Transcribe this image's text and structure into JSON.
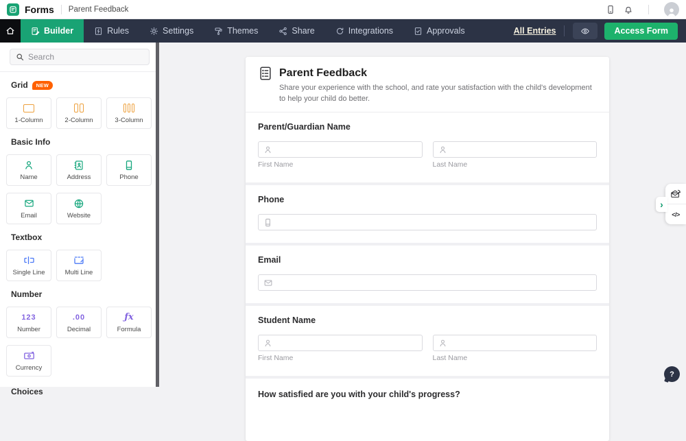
{
  "topbar": {
    "brand": "Forms",
    "form_name": "Parent Feedback"
  },
  "nav": {
    "tabs": [
      {
        "label": "Builder",
        "active": true
      },
      {
        "label": "Rules",
        "active": false
      },
      {
        "label": "Settings",
        "active": false
      },
      {
        "label": "Themes",
        "active": false
      },
      {
        "label": "Share",
        "active": false
      },
      {
        "label": "Integrations",
        "active": false
      },
      {
        "label": "Approvals",
        "active": false
      }
    ],
    "all_entries_label": "All Entries",
    "access_form_label": "Access Form"
  },
  "sidebar": {
    "search_placeholder": "Search",
    "sections": [
      {
        "title": "Grid",
        "badge": "NEW",
        "items": [
          {
            "label": "1-Column"
          },
          {
            "label": "2-Column"
          },
          {
            "label": "3-Column"
          }
        ]
      },
      {
        "title": "Basic Info",
        "items": [
          {
            "label": "Name"
          },
          {
            "label": "Address"
          },
          {
            "label": "Phone"
          },
          {
            "label": "Email"
          },
          {
            "label": "Website"
          }
        ]
      },
      {
        "title": "Textbox",
        "items": [
          {
            "label": "Single Line"
          },
          {
            "label": "Multi Line"
          }
        ]
      },
      {
        "title": "Number",
        "items": [
          {
            "label": "Number",
            "icon_text": "123"
          },
          {
            "label": "Decimal",
            "icon_text": ".00"
          },
          {
            "label": "Formula",
            "icon_text": "ƒx"
          },
          {
            "label": "Currency"
          }
        ]
      },
      {
        "title": "Choices",
        "items": []
      }
    ]
  },
  "form": {
    "title": "Parent Feedback",
    "description": "Share your experience with the school, and rate your satisfaction with the child's development to help your child do better.",
    "fields": [
      {
        "label": "Parent/Guardian Name",
        "sublabels": [
          "First Name",
          "Last Name"
        ]
      },
      {
        "label": "Phone"
      },
      {
        "label": "Email"
      },
      {
        "label": "Student Name",
        "sublabels": [
          "First Name",
          "Last Name"
        ]
      },
      {
        "label": "How satisfied are you with your child's progress?"
      }
    ]
  },
  "drawer": {
    "code_glyph": "</>",
    "chevron_glyph": "›"
  },
  "help": {
    "glyph": "?"
  },
  "colors": {
    "nav_bg": "#2c3345",
    "brand_green": "#19a374",
    "access_green": "#1db26c",
    "badge_orange": "#ff6100",
    "grid_icon": "#eda03c",
    "basic_icon": "#16a67d",
    "textbox_icon": "#4b79f6",
    "number_icon": "#8263e0"
  }
}
